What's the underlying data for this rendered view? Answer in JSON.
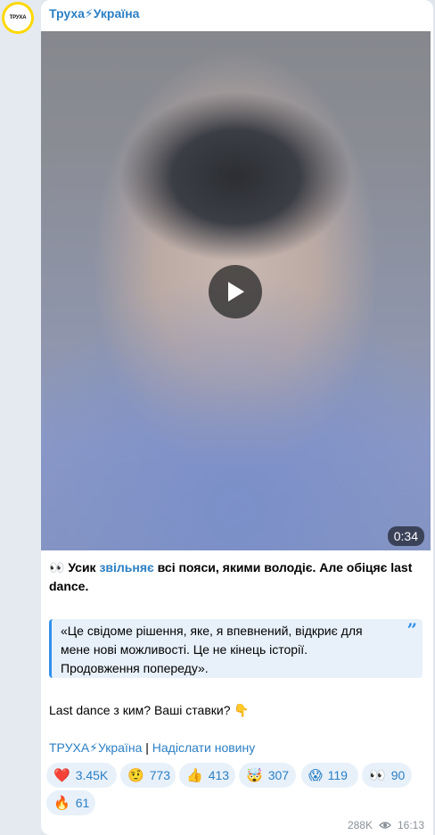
{
  "channel": {
    "name": "Труха⚡Україна",
    "avatar_text": "ТРУХА"
  },
  "video": {
    "duration": "0:34"
  },
  "post": {
    "line1_emoji": "👀",
    "line1_a": "Усик",
    "line1_link": "звільняє",
    "line1_b": "всі пояси, якими володіє. Але обіцяє last",
    "line2": "dance.",
    "quote_line1": "«Це свідоме рішення, яке, я впевнений, відкриє для",
    "quote_line2": "мене нові можливості. Це не кінець історії.",
    "quote_line3": "Продовження попереду».",
    "question": "Last dance з ким? Ваші ставки?",
    "question_emoji": "👇",
    "footer_channel_link": "ТРУХА⚡Україна",
    "footer_separator": "|",
    "footer_submit_link": "Надіслати новину"
  },
  "reactions": [
    {
      "emoji": "❤️",
      "count": "3.45K"
    },
    {
      "emoji": "🤨",
      "count": "773"
    },
    {
      "emoji": "👍",
      "count": "413"
    },
    {
      "emoji": "🤯",
      "count": "307"
    },
    {
      "emoji": "😱",
      "count": "119"
    },
    {
      "emoji": "👀",
      "count": "90"
    },
    {
      "emoji": "🔥",
      "count": "61"
    }
  ],
  "meta": {
    "views": "288K",
    "time": "16:13"
  },
  "colors": {
    "accent": "#2b7fc4",
    "quote_bar": "#3390ec",
    "reaction_bg": "#e8f1fa"
  }
}
